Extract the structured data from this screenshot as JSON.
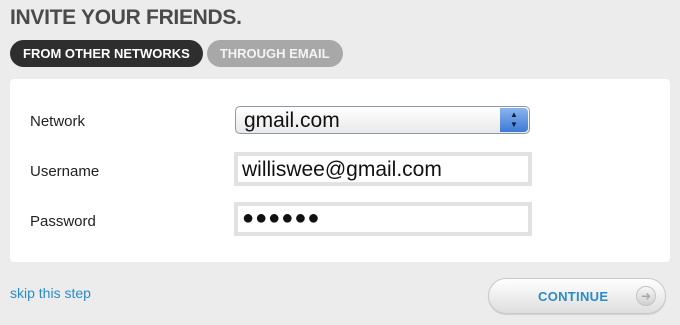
{
  "page": {
    "title": "INVITE YOUR FRIENDS."
  },
  "tabs": [
    {
      "label": "FROM OTHER NETWORKS",
      "active": true
    },
    {
      "label": "THROUGH EMAIL",
      "active": false
    }
  ],
  "form": {
    "network": {
      "label": "Network",
      "value": "gmail.com",
      "icon": "updown-arrows-icon"
    },
    "username": {
      "label": "Username",
      "value": "williswee@gmail.com"
    },
    "password": {
      "label": "Password",
      "value": "●●●●●●"
    }
  },
  "actions": {
    "skip_label": "skip this step",
    "continue_label": "CONTINUE",
    "continue_icon": "arrow-right-icon"
  },
  "colors": {
    "link": "#2a8bc9",
    "active_tab": "#2e2e2e",
    "inactive_tab": "#a8a8a8",
    "background": "#ececec"
  }
}
